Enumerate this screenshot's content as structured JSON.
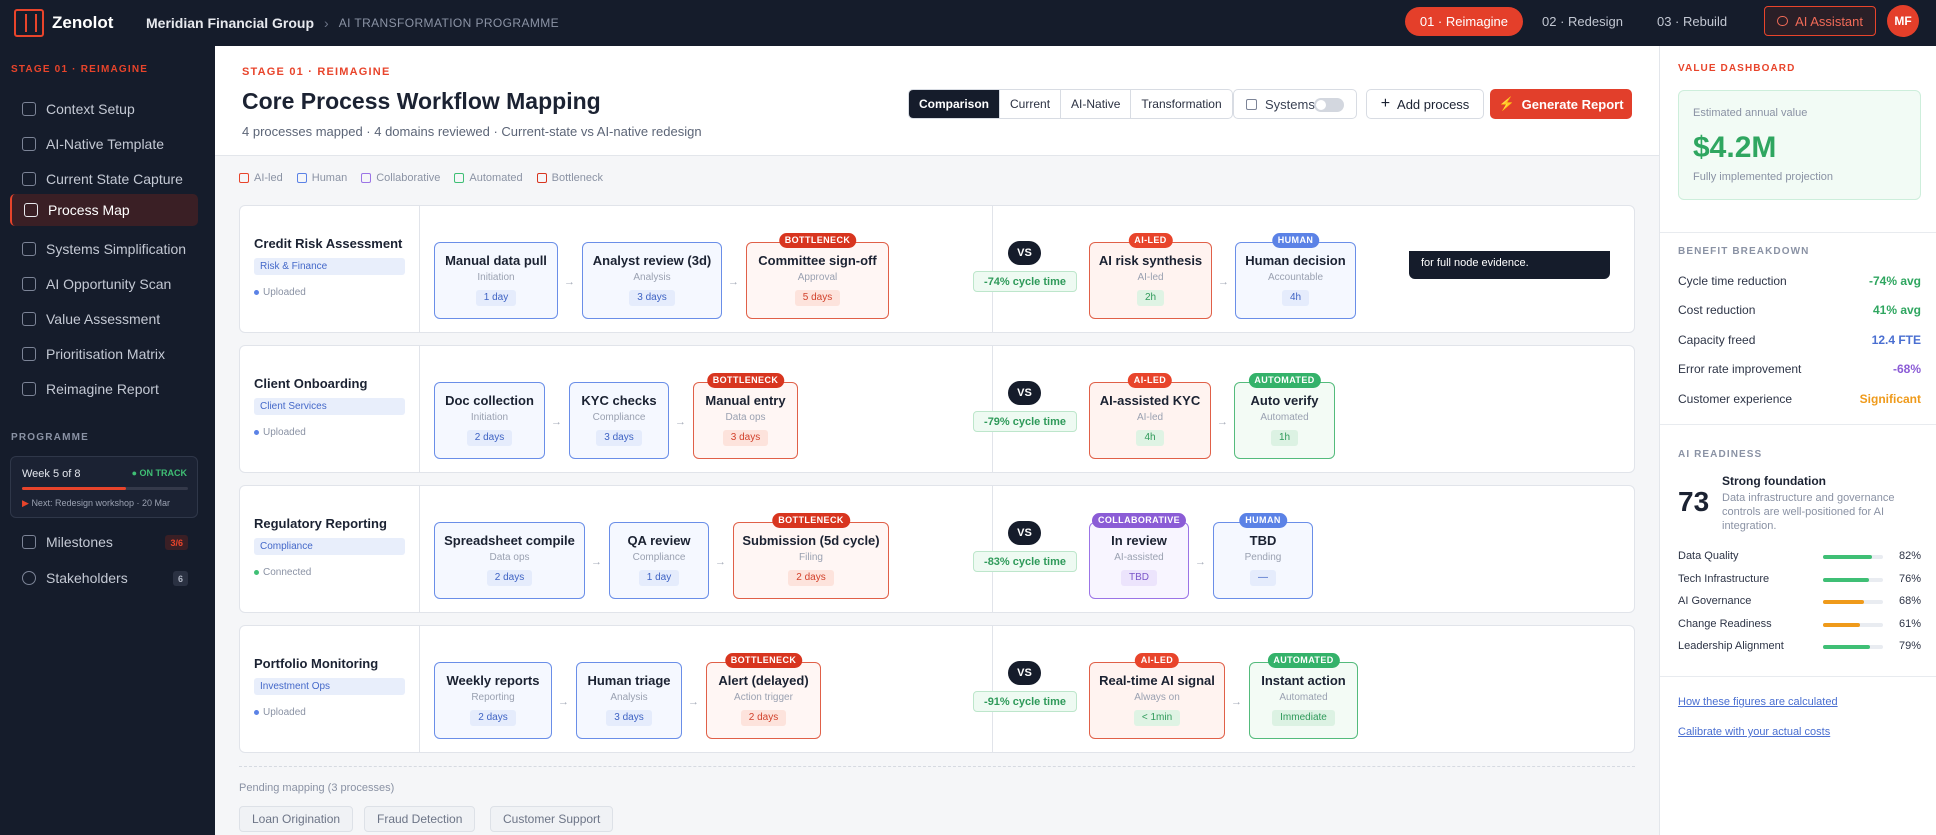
{
  "brand": {
    "name": "Zenolot"
  },
  "header": {
    "org": "Meridian Financial Group",
    "separator": "›",
    "programme": "AI TRANSFORMATION PROGRAMME",
    "stages": [
      "01 · Reimagine",
      "02 · Redesign",
      "03 · Rebuild"
    ],
    "ai_assistant": "AI Assistant",
    "avatar": "MF"
  },
  "sidebar": {
    "stage_label": "STAGE 01 · REIMAGINE",
    "items": [
      {
        "label": "Context Setup",
        "icon": "gear-icon"
      },
      {
        "label": "AI-Native Template",
        "icon": "sparkle-icon"
      },
      {
        "label": "Current State Capture",
        "icon": "document-icon"
      },
      {
        "label": "Process Map",
        "icon": "map-icon"
      },
      {
        "label": "Systems Simplification",
        "icon": "layers-icon"
      },
      {
        "label": "AI Opportunity Scan",
        "icon": "target-icon"
      },
      {
        "label": "Value Assessment",
        "icon": "trend-icon"
      },
      {
        "label": "Prioritisation Matrix",
        "icon": "grid-icon"
      },
      {
        "label": "Reimagine Report",
        "icon": "report-icon"
      }
    ],
    "programme_label": "PROGRAMME",
    "week": {
      "title": "Week 5 of 8",
      "status": "● ON TRACK",
      "progress": 0.625,
      "next_arrow": "▶",
      "next": "Next: Redesign workshop · 20 Mar"
    },
    "milestones": {
      "label": "Milestones",
      "badge": "3/6"
    },
    "stakeholders": {
      "label": "Stakeholders",
      "badge": "6"
    }
  },
  "page": {
    "stage_label": "STAGE 01 · REIMAGINE",
    "title": "Core Process Workflow Mapping",
    "subtitle": "4 processes mapped · 4 domains reviewed · Current-state vs AI-native redesign",
    "views": [
      "Comparison",
      "Current",
      "AI-Native",
      "Transformation"
    ],
    "systems_label": "Systems",
    "add_process": "Add process",
    "generate_report": "Generate Report"
  },
  "legend": [
    {
      "label": "AI-led",
      "color": "#e8442b"
    },
    {
      "label": "Human",
      "color": "#5b82e6"
    },
    {
      "label": "Collaborative",
      "color": "#9b74e6"
    },
    {
      "label": "Automated",
      "color": "#3fbf75"
    },
    {
      "label": "Bottleneck",
      "color": "#d8351f"
    }
  ],
  "tooltip": "for full node evidence.",
  "vs_label": "VS",
  "processes": [
    {
      "name": "Credit Risk Assessment",
      "domain": "Risk & Finance",
      "status": "Uploaded",
      "current": [
        {
          "title": "Manual data pull",
          "stage": "Initiation",
          "dur": "1 day"
        },
        {
          "title": "Analyst review (3d)",
          "stage": "Analysis",
          "dur": "3 days"
        },
        {
          "title": "Committee sign-off",
          "stage": "Approval",
          "dur": "5 days",
          "badge": "BOTTLENECK"
        }
      ],
      "cycle": "-74% cycle time",
      "future": [
        {
          "title": "AI risk synthesis",
          "stage": "AI-led",
          "dur": "2h",
          "badge": "AI-LED"
        },
        {
          "title": "Human decision",
          "stage": "Accountable",
          "dur": "4h",
          "badge": "HUMAN"
        }
      ]
    },
    {
      "name": "Client Onboarding",
      "domain": "Client Services",
      "status": "Uploaded",
      "current": [
        {
          "title": "Doc collection",
          "stage": "Initiation",
          "dur": "2 days"
        },
        {
          "title": "KYC checks",
          "stage": "Compliance",
          "dur": "3 days"
        },
        {
          "title": "Manual entry",
          "stage": "Data ops",
          "dur": "3 days",
          "badge": "BOTTLENECK"
        }
      ],
      "cycle": "-79% cycle time",
      "future": [
        {
          "title": "AI-assisted KYC",
          "stage": "AI-led",
          "dur": "4h",
          "badge": "AI-LED"
        },
        {
          "title": "Auto verify",
          "stage": "Automated",
          "dur": "1h",
          "badge": "AUTOMATED"
        }
      ]
    },
    {
      "name": "Regulatory Reporting",
      "domain": "Compliance",
      "status": "Connected",
      "current": [
        {
          "title": "Spreadsheet compile",
          "stage": "Data ops",
          "dur": "2 days"
        },
        {
          "title": "QA review",
          "stage": "Compliance",
          "dur": "1 day"
        },
        {
          "title": "Submission (5d cycle)",
          "stage": "Filing",
          "dur": "2 days",
          "badge": "BOTTLENECK"
        }
      ],
      "cycle": "-83% cycle time",
      "future": [
        {
          "title": "In review",
          "stage": "AI-assisted",
          "dur": "TBD",
          "badge": "COLLABORATIVE"
        },
        {
          "title": "TBD",
          "stage": "Pending",
          "dur": "—",
          "badge": "HUMAN"
        }
      ]
    },
    {
      "name": "Portfolio Monitoring",
      "domain": "Investment Ops",
      "status": "Uploaded",
      "current": [
        {
          "title": "Weekly reports",
          "stage": "Reporting",
          "dur": "2 days"
        },
        {
          "title": "Human triage",
          "stage": "Analysis",
          "dur": "3 days"
        },
        {
          "title": "Alert (delayed)",
          "stage": "Action trigger",
          "dur": "2 days",
          "badge": "BOTTLENECK"
        }
      ],
      "cycle": "-91% cycle time",
      "future": [
        {
          "title": "Real-time AI signal",
          "stage": "Always on",
          "dur": "< 1min",
          "badge": "AI-LED"
        },
        {
          "title": "Instant action",
          "stage": "Automated",
          "dur": "Immediate",
          "badge": "AUTOMATED"
        }
      ]
    }
  ],
  "pending": {
    "label": "Pending mapping (3 processes)",
    "items": [
      "Loan Origination",
      "Fraud Detection",
      "Customer Support"
    ]
  },
  "dashboard": {
    "title": "VALUE DASHBOARD",
    "est_label": "Estimated annual value",
    "est_value": "$4.2M",
    "est_sub": "Fully implemented projection",
    "benefit_title": "BENEFIT BREAKDOWN",
    "benefits": [
      {
        "label": "Cycle time reduction",
        "value": "-74% avg",
        "color": "#2fa660"
      },
      {
        "label": "Cost reduction",
        "value": "41% avg",
        "color": "#2fa660"
      },
      {
        "label": "Capacity freed",
        "value": "12.4 FTE",
        "color": "#4a6fd1"
      },
      {
        "label": "Error rate improvement",
        "value": "-68%",
        "color": "#8b5cd6"
      },
      {
        "label": "Customer experience",
        "value": "Significant",
        "color": "#ef9a1a"
      }
    ],
    "readiness_title": "AI READINESS",
    "score": "73",
    "score_title": "Strong foundation",
    "score_desc": "Data infrastructure and governance controls are well-positioned for AI integration.",
    "readiness": [
      {
        "label": "Data Quality",
        "pct": "82%",
        "value": 0.82,
        "color": "#3fbf75"
      },
      {
        "label": "Tech Infrastructure",
        "pct": "76%",
        "value": 0.76,
        "color": "#3fbf75"
      },
      {
        "label": "AI Governance",
        "pct": "68%",
        "value": 0.68,
        "color": "#ef9a1a"
      },
      {
        "label": "Change Readiness",
        "pct": "61%",
        "value": 0.61,
        "color": "#ef9a1a"
      },
      {
        "label": "Leadership Alignment",
        "pct": "79%",
        "value": 0.79,
        "color": "#3fbf75"
      }
    ],
    "link1": "How these figures are calculated",
    "link2": "Calibrate with your actual costs"
  }
}
